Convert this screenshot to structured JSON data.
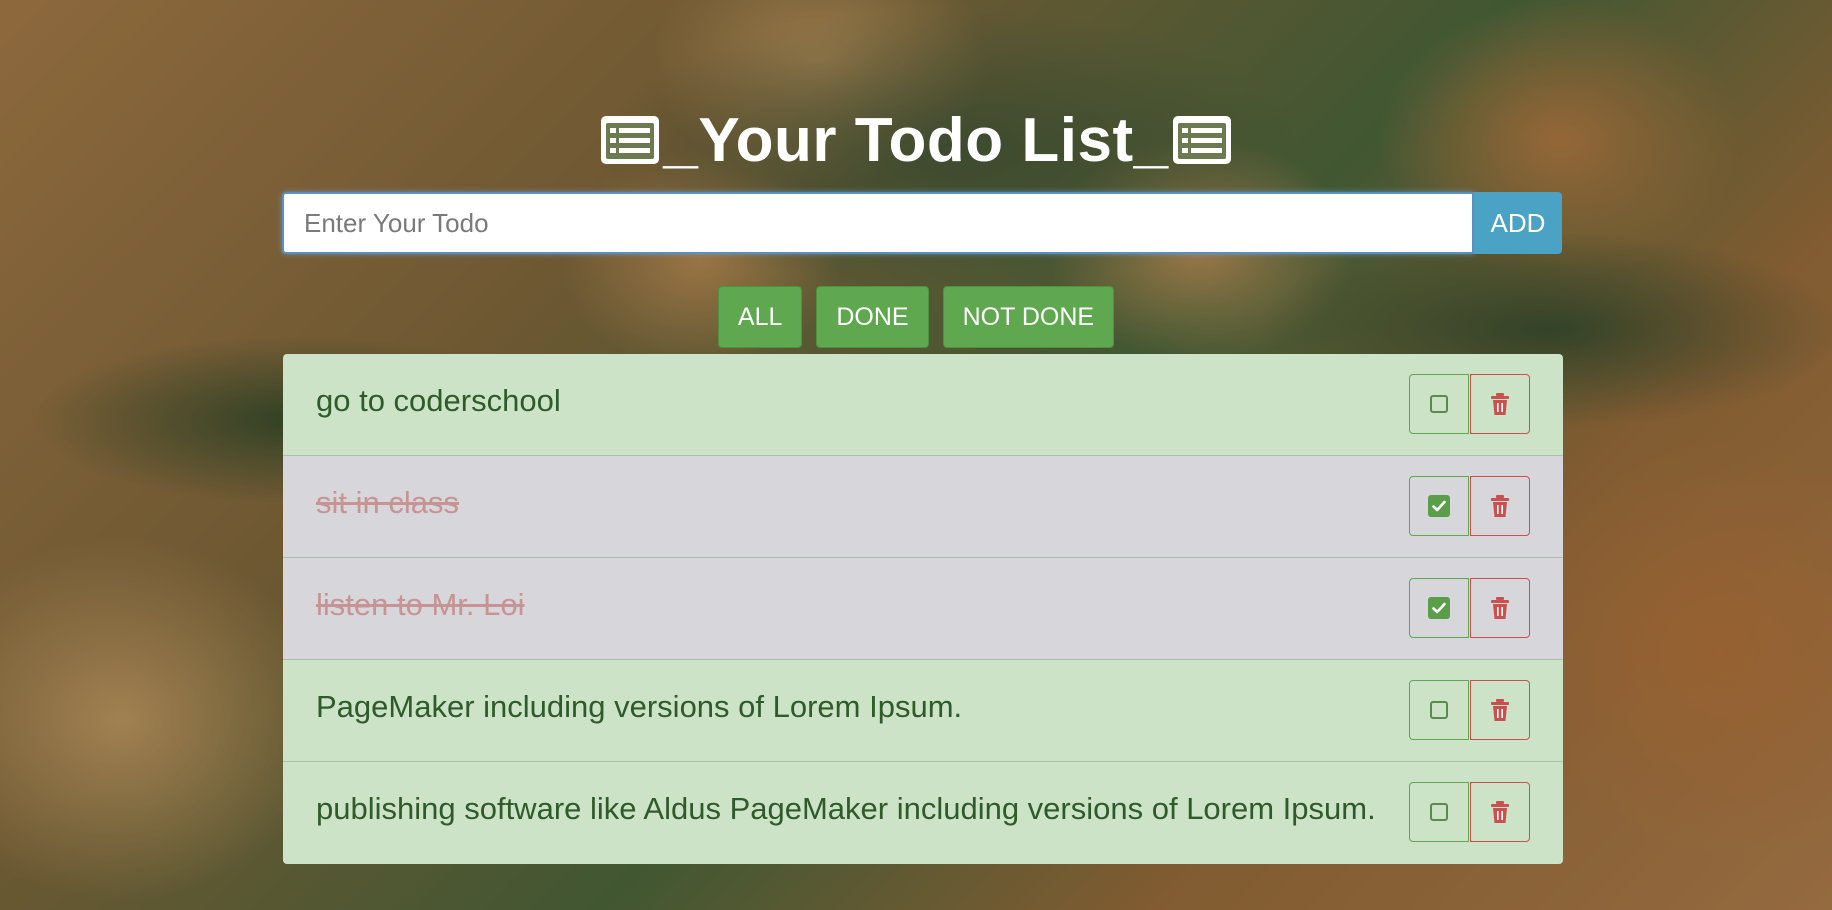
{
  "header": {
    "title_prefix": "_Your Todo List_",
    "icon": "list-alt-icon"
  },
  "add_form": {
    "placeholder": "Enter Your Todo",
    "value": "",
    "add_label": "ADD"
  },
  "filters": [
    {
      "label": "ALL"
    },
    {
      "label": "DONE"
    },
    {
      "label": "NOT DONE"
    }
  ],
  "todos": [
    {
      "text": "go to coderschool",
      "done": false
    },
    {
      "text": "sit in class",
      "done": true
    },
    {
      "text": "listen to Mr. Loi",
      "done": true
    },
    {
      "text": "PageMaker including versions of Lorem Ipsum.",
      "done": false
    },
    {
      "text": "publishing software like Aldus PageMaker including versions of Lorem Ipsum.",
      "done": false
    }
  ],
  "icons": {
    "done_toggle": "checkbox-icon",
    "delete": "trash-icon"
  },
  "colors": {
    "open_row": "#cde3c8",
    "done_row": "#d6d6db",
    "accent_green": "#5fa84f",
    "add_blue": "#4aa3c4",
    "delete_red": "#c9504f"
  }
}
